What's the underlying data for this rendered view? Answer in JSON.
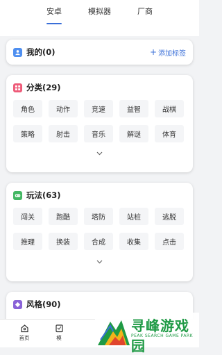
{
  "tabs": [
    {
      "label": "安卓",
      "active": true
    },
    {
      "label": "模拟器",
      "active": false
    },
    {
      "label": "厂商",
      "active": false
    }
  ],
  "mine": {
    "title": "我的(0)",
    "add_label": "添加标签"
  },
  "categories": {
    "title": "分类(29)",
    "items": [
      "角色",
      "动作",
      "竞速",
      "益智",
      "战棋",
      "策略",
      "射击",
      "音乐",
      "解谜",
      "体育"
    ]
  },
  "gameplay": {
    "title": "玩法(63)",
    "items": [
      "闯关",
      "跑酷",
      "塔防",
      "站桩",
      "逃脱",
      "推理",
      "换装",
      "合成",
      "收集",
      "点击"
    ]
  },
  "style": {
    "title": "风格(90)"
  },
  "bottom_nav": {
    "home": "首页",
    "second": "模"
  },
  "watermark": {
    "title": "寻峰游戏园",
    "subtitle": "PEAK SEARCH GAME PARK"
  },
  "colors": {
    "accent": "#3a6fd8",
    "mine_icon": "#4f8ff0",
    "cat_icon": "#ee5a78",
    "play_icon": "#43b763",
    "style_icon": "#8a63d8"
  }
}
